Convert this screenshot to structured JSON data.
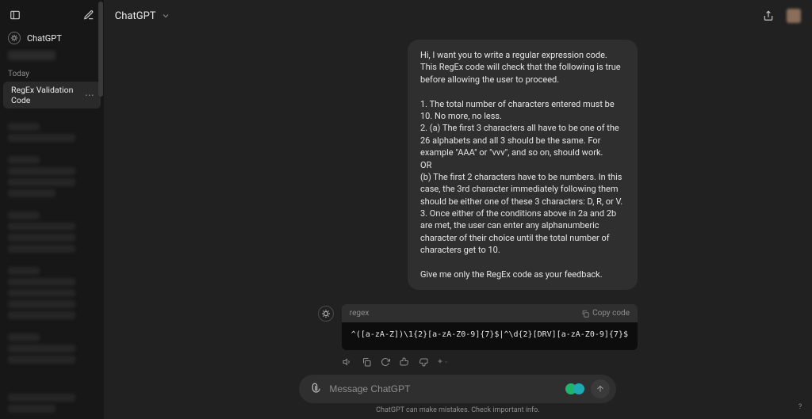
{
  "sidebar": {
    "app_label": "ChatGPT",
    "section_today": "Today",
    "active_convo": "RegEx Validation Code"
  },
  "header": {
    "model_name": "ChatGPT"
  },
  "conversation": {
    "user_message": "Hi, I want you to write a regular expression code. This RegEx code will check that the following is true before allowing the user to proceed.\n\n1. The total number of characters entered must be 10. No more, no less.\n2. (a) The first 3 characters all have to be one of the 26 alphabets and all 3 should be the same. For example \"AAA\" or \"vvv\", and so on, should work.\nOR\n(b) The first 2 characters have to be numbers. In this case, the 3rd character immediately following them should be either one of these 3 characters: D, R, or V.\n3. Once either of the conditions above in 2a and 2b are met, the user can enter any alphanumberic character of their choice until the total number of characters get to 10.\n\nGive me only the RegEx code as your feedback.",
    "code_lang": "regex",
    "copy_label": "Copy code",
    "code_content": "^([a-zA-Z])\\1{2}[a-zA-Z0-9]{7}$|^\\d{2}[DRV][a-zA-Z0-9]{7}$"
  },
  "composer": {
    "placeholder": "Message ChatGPT"
  },
  "footer": {
    "disclaimer": "ChatGPT can make mistakes. Check important info."
  },
  "icons": {
    "sidebar_toggle": "sidebar-toggle-icon",
    "new_chat": "new-chat-icon",
    "share": "share-icon",
    "attach": "paperclip-icon",
    "send": "arrow-up-icon",
    "speaker": "speaker-icon",
    "clipboard": "clipboard-icon",
    "regen": "refresh-icon",
    "thumbs_up": "thumbs-up-icon",
    "thumbs_down": "thumbs-down-icon",
    "sparkle": "sparkle-icon",
    "help": "help-icon"
  }
}
